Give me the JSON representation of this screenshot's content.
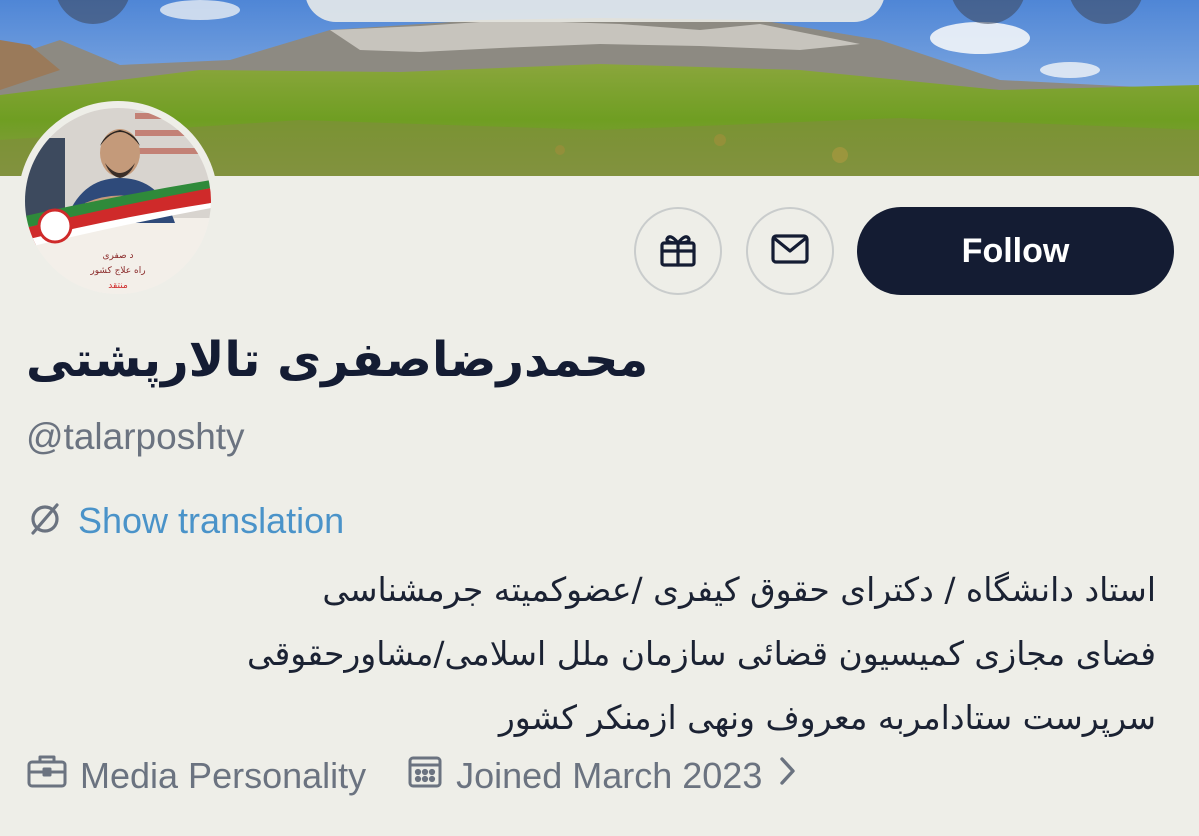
{
  "profile": {
    "display_name": "محمدرضاصفری تالارپشتی",
    "handle": "@talarposhty",
    "show_translation": "Show translation",
    "bio_lines": [
      "استاد دانشگاه / دکترای حقوق کیفری /عضوکمیته جرمشناسی",
      "فضای مجازی کمیسیون قضائی سازمان ملل اسلامی/مشاورحقوقی",
      "سرپرست ستادامربه معروف ونهی ازمنکر کشور"
    ],
    "category": "Media Personality",
    "joined": "Joined March 2023"
  },
  "actions": {
    "follow_label": "Follow",
    "gift_icon": "gift-icon",
    "message_icon": "mail-icon"
  },
  "colors": {
    "follow_bg": "#141c33",
    "link": "#4a93c9",
    "muted": "#6b7380",
    "text": "#141c33"
  }
}
